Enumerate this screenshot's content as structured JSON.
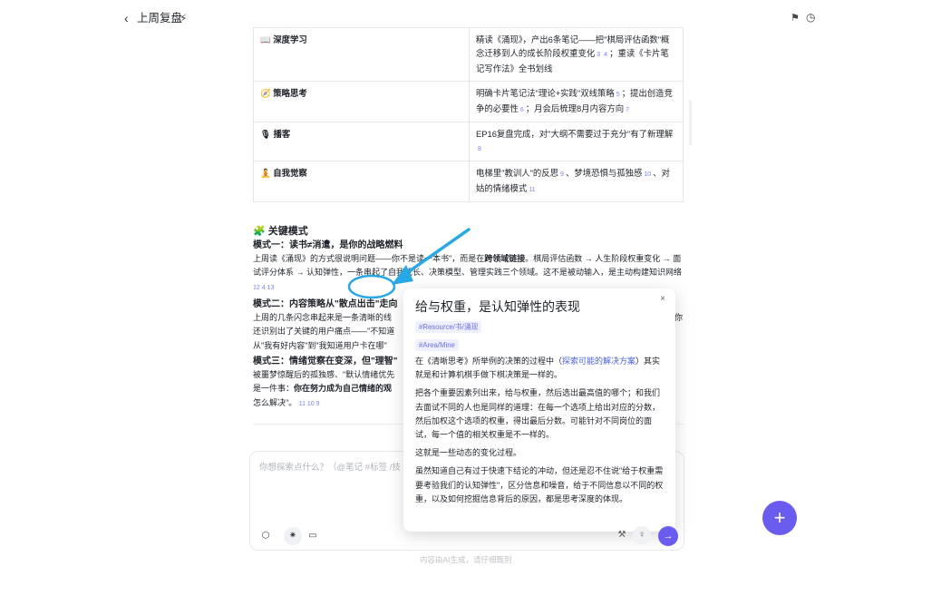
{
  "header": {
    "title": "上周复盘",
    "back_icon": "chevron-left-icon",
    "wand_icon": "magic-wand-icon",
    "flag_icon": "flag-icon",
    "history_icon": "history-icon"
  },
  "table": {
    "rows": [
      {
        "icon": "📖",
        "label": "深度学习",
        "content_parts": [
          "精读《涌现》，产出6条笔记——把\"棋局评估函数\"概念迁移到人的成长阶段权重变化",
          "；重读《卡片笔记写作法》全书划线"
        ],
        "cites": [
          [
            "3",
            "4"
          ]
        ]
      },
      {
        "icon": "🧭",
        "label": "策略思考",
        "content_parts": [
          "明确卡片笔记法\"理论+实践\"双线策略",
          "；提出创造竞争的必要性",
          "；月会后梳理8月内容方向",
          ""
        ],
        "cites": [
          [
            "5"
          ],
          [
            "6"
          ],
          [
            "7"
          ]
        ]
      },
      {
        "icon": "🎙",
        "label": "播客",
        "content_parts": [
          "EP16复盘完成，对\"大纲不需要过于充分\"有了新理解",
          ""
        ],
        "cites": [
          [
            "8"
          ]
        ]
      },
      {
        "icon": "🧘",
        "label": "自我觉察",
        "content_parts": [
          "电梯里\"教训人\"的反思",
          "、梦境恐惧与孤独感",
          "、对姑的情绪模式",
          ""
        ],
        "cites": [
          [
            "9"
          ],
          [
            "10"
          ],
          [
            "11"
          ]
        ]
      }
    ]
  },
  "section": {
    "icon": "🧩",
    "title": "关键模式",
    "pattern1_title": "模式一：读书≠消遣，是你的战略燃料",
    "pattern1_a": "上周读《涌现》的方式很说明问题——你不是",
    "pattern1_b": "读一本书\"，而是在",
    "pattern1_bold": "跨领域链接",
    "pattern1_c": "。棋局评估函数 → 人生阶段权重变化 → 面试评分体系 → 认知弹性，一条",
    "pattern1_d": "串起了自我成长、决策模型、管理实践三个领域。这不是被动输入，是主动构建知识网络",
    "pattern1_cites": "12  4  13",
    "pattern2_title": "模式二：内容策略从\"散点出击\"走向",
    "pattern2_a": "上周的几条闪念串起来是一条清晰的线",
    "pattern2_b": "还识别出了关键的用户痛点——\"不知道",
    "pattern2_c": "从\"我有好内容\"到\"我知道用户卡在哪\"",
    "pattern3_title": "模式三：情绪觉察在变深，但\"理智\"",
    "pattern3_a": "被噩梦惊醒后的孤独感、\"默认情绪优先",
    "pattern3_b": "是一件事：",
    "pattern3_bold": "你在努力成为自己情绪的观",
    "pattern3_c": "怎么解决\"。",
    "pattern3_cites": "11  10  9",
    "cut_right": "你"
  },
  "chat": {
    "placeholder": "你想探索点什么？（@笔记 #标签 /技",
    "tool_icons": [
      "cube-icon",
      "spark-refresh-icon",
      "chat-bubble-icon"
    ],
    "footer": "内容由AI生成，请仔细甄别"
  },
  "popup": {
    "title": "给与权重，是认知弹性的表现",
    "tag1": "#Resource/书/涌现",
    "tag2": "#Area/Mine",
    "p1_a": "在《清晰思考》所举例的决策的过程中（",
    "p1_link": "探索可能的解决方案",
    "p1_b": "）其实就是和计算机棋手做下棋决策是一样的。",
    "p2": "把各个重要因素列出来，给与权重，然后选出最高值的哪个；和我们去面试不同的人也是同样的道理：在每一个选项上给出对应的分数，然后加权这个选项的权重，得出最后分数。可能针对不同岗位的面试，每一个值的相关权重是不一样的。",
    "p3": "这就是一些动态的变化过程。",
    "p4": "虽然知道自己有过于快速下结论的冲动，但还是忍不住说\"给于权重需要考验我们的认知弹性\"，区分信息和噪音，给于不同信息以不同的权重，以及如何挖掘信息背后的原因，都是思考深度的体现。",
    "close_icon": "close-icon",
    "bottom_icons": [
      "tools-icon",
      "lightbulb-icon"
    ]
  },
  "actions": {
    "fab_icon": "plus-icon",
    "fab_label": "+",
    "send_icon": "send-arrow-icon",
    "send_label": "→"
  },
  "colors": {
    "accent": "#6b5cf0",
    "cite": "#7a7ff0",
    "annotation": "#29a8e8"
  }
}
